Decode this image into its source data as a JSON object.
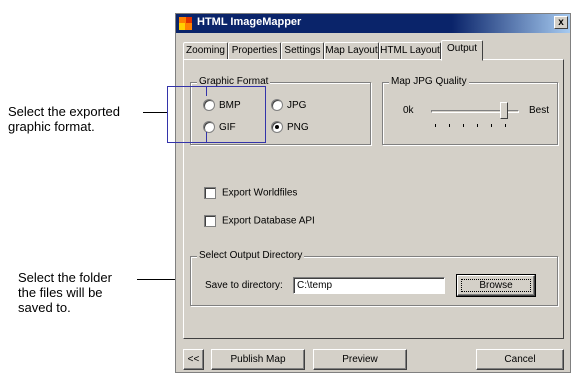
{
  "callouts": {
    "format_lines": [
      "Select the exported",
      "graphic format."
    ],
    "folder_lines": [
      "Select the folder",
      "the files will be",
      "saved to."
    ]
  },
  "window": {
    "title": "HTML ImageMapper",
    "close_glyph": "x"
  },
  "tabs": [
    {
      "label": "Zooming"
    },
    {
      "label": "Properties"
    },
    {
      "label": "Settings"
    },
    {
      "label": "Map Layout"
    },
    {
      "label": "HTML Layout"
    },
    {
      "label": "Output",
      "active": true
    }
  ],
  "graphic_format": {
    "legend": "Graphic Format",
    "options": [
      "BMP",
      "JPG",
      "GIF",
      "PNG"
    ],
    "selected": "PNG"
  },
  "jpg_quality": {
    "legend": "Map JPG Quality",
    "low_label": "0k",
    "high_label": "Best",
    "level": 0.82
  },
  "checkboxes": {
    "export_worldfiles": {
      "label": "Export Worldfiles",
      "checked": false
    },
    "export_database_api": {
      "label": "Export Database API",
      "checked": false
    }
  },
  "output_dir": {
    "legend": "Select Output Directory",
    "label": "Save to directory:",
    "value": "C:\\temp",
    "browse_label": "Browse"
  },
  "footer": {
    "back_label": "<<",
    "publish_label": "Publish Map",
    "preview_label": "Preview",
    "cancel_label": "Cancel"
  },
  "colors": {
    "callout_line": "#3333aa",
    "title_bar": "#0a246a",
    "face": "#d4d0c8"
  }
}
